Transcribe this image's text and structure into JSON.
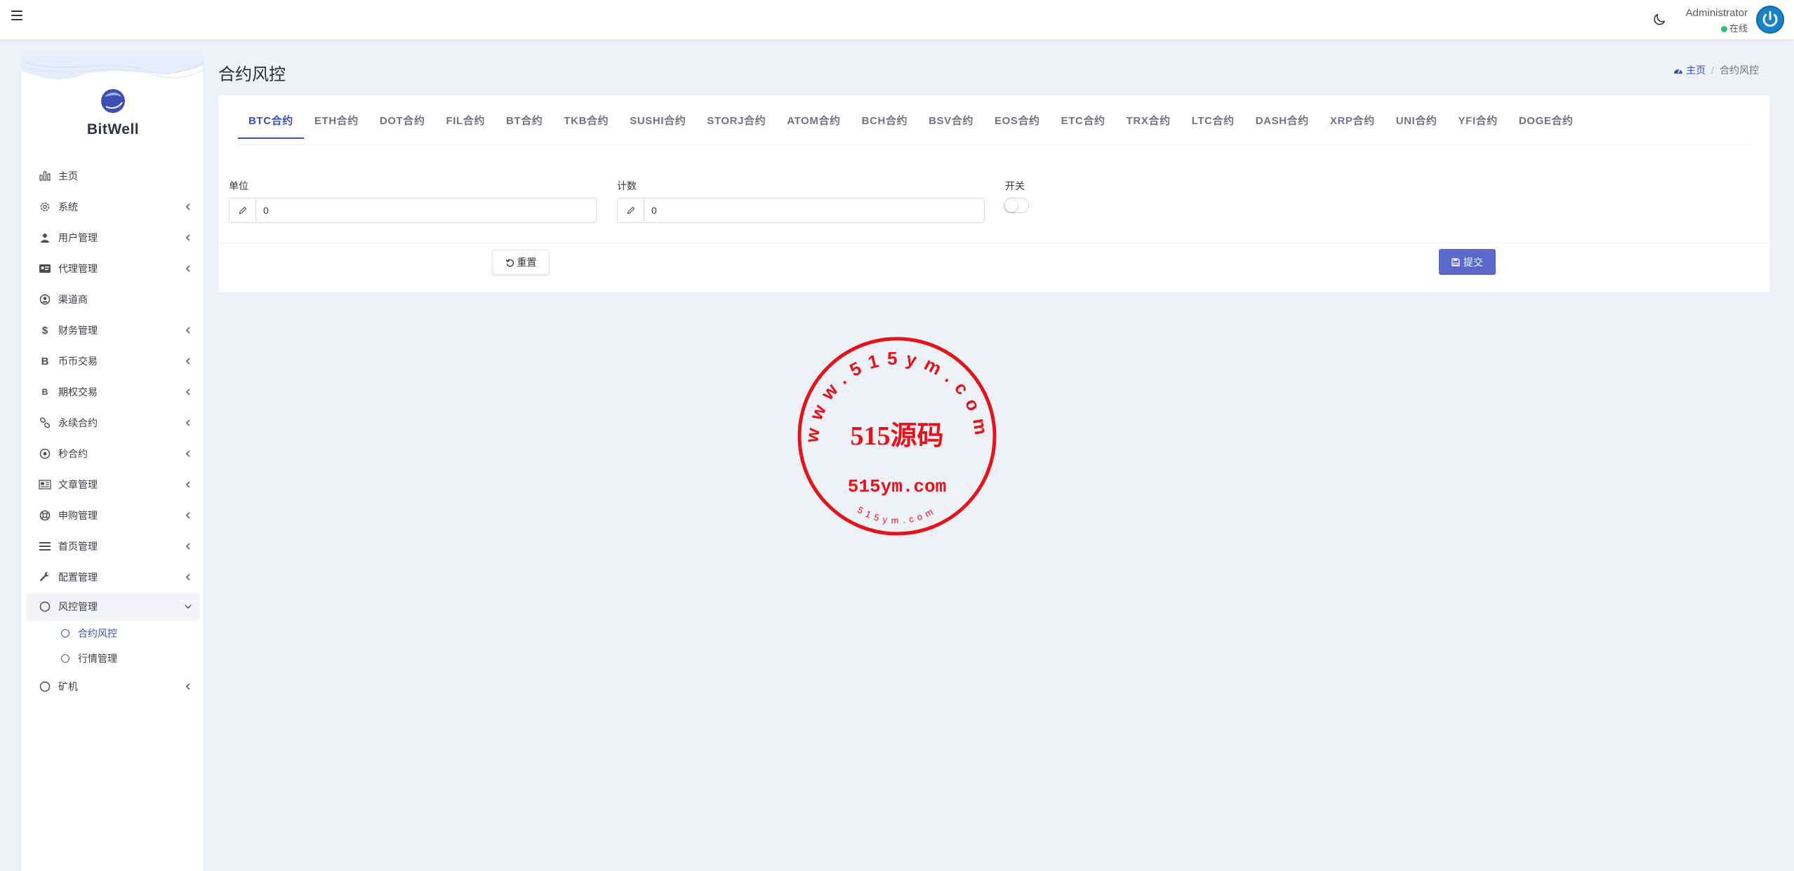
{
  "header": {
    "admin_name": "Administrator",
    "status": "在线"
  },
  "sidebar": {
    "brand": "BitWell",
    "items": [
      {
        "label": "主页",
        "icon": "chart-icon",
        "has_children": false
      },
      {
        "label": "系统",
        "icon": "gear-icon",
        "has_children": true
      },
      {
        "label": "用户管理",
        "icon": "user-tie-icon",
        "has_children": true
      },
      {
        "label": "代理管理",
        "icon": "id-card-icon",
        "has_children": true
      },
      {
        "label": "渠道商",
        "icon": "user-circle-icon",
        "has_children": false
      },
      {
        "label": "财务管理",
        "icon": "dollar-icon",
        "has_children": true
      },
      {
        "label": "币币交易",
        "icon": "bitcoin-icon",
        "has_children": true
      },
      {
        "label": "期权交易",
        "icon": "bitcoin-small-icon",
        "has_children": true
      },
      {
        "label": "永续合约",
        "icon": "link-icon",
        "has_children": true
      },
      {
        "label": "秒合约",
        "icon": "dot-circle-icon",
        "has_children": true
      },
      {
        "label": "文章管理",
        "icon": "newspaper-icon",
        "has_children": true
      },
      {
        "label": "申购管理",
        "icon": "lifebuoy-icon",
        "has_children": true
      },
      {
        "label": "首页管理",
        "icon": "list-icon",
        "has_children": true
      },
      {
        "label": "配置管理",
        "icon": "wrench-icon",
        "has_children": true
      },
      {
        "label": "风控管理",
        "icon": "circle-icon",
        "has_children": true,
        "expanded": true
      },
      {
        "label": "矿机",
        "icon": "circle-icon",
        "has_children": true
      }
    ],
    "submenu": [
      {
        "label": "合约风控",
        "active": true
      },
      {
        "label": "行情管理",
        "active": false
      }
    ]
  },
  "page": {
    "title": "合约风控",
    "breadcrumb": {
      "home": "主页",
      "current": "合约风控"
    }
  },
  "tabs": [
    "BTC合约",
    "ETH合约",
    "DOT合约",
    "FIL合约",
    "BT合约",
    "TKB合约",
    "SUSHI合约",
    "STORJ合约",
    "ATOM合约",
    "BCH合约",
    "BSV合约",
    "EOS合约",
    "ETC合约",
    "TRX合约",
    "LTC合约",
    "DASH合约",
    "XRP合约",
    "UNI合约",
    "YFI合约",
    "DOGE合约"
  ],
  "active_tab": 0,
  "form": {
    "unit_label": "单位",
    "unit_value": "0",
    "count_label": "计数",
    "count_value": "0",
    "switch_label": "开关",
    "switch_on": false,
    "reset_label": "重置",
    "submit_label": "提交"
  },
  "watermark": {
    "center": "515源码",
    "sub": "515ym.com",
    "ring": "www.515ym.com",
    "bottom": "515ym.com"
  },
  "colors": {
    "accent": "#3b4fb5",
    "submit": "#5a68c9",
    "stamp": "#e3121b",
    "online": "#2ec27e",
    "avatar": "#1a82c9"
  }
}
